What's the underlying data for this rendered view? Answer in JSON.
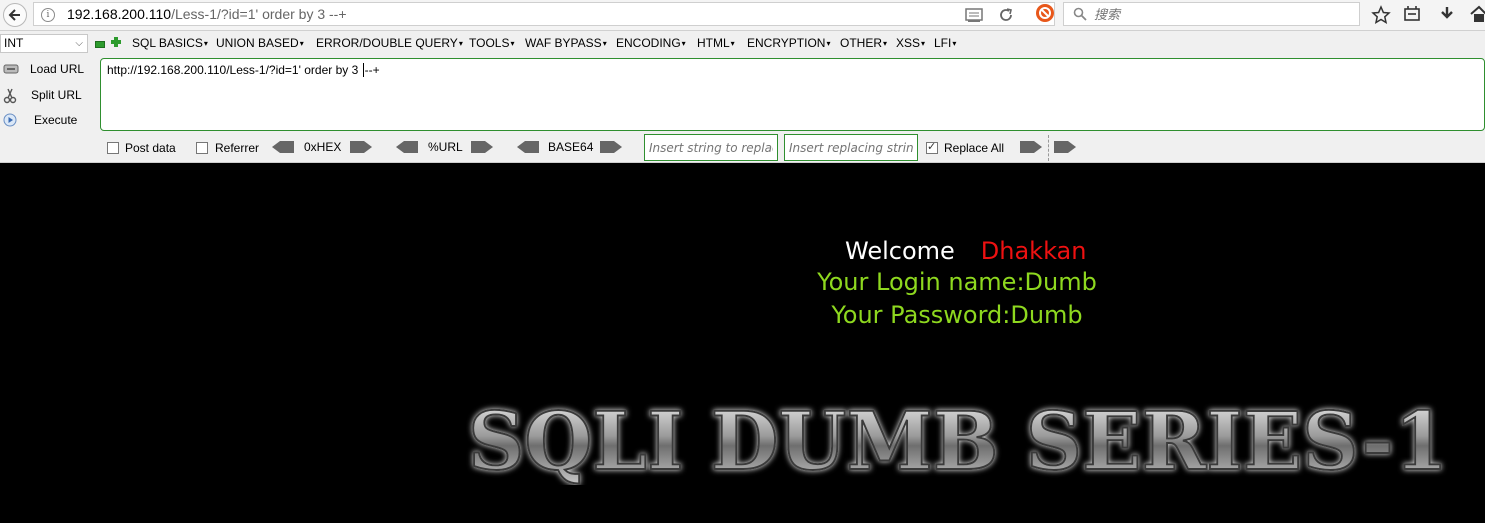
{
  "browser": {
    "url_host": "192.168.200.110",
    "url_path": "/Less-1/?id=1' order by 3 --+",
    "search_placeholder": "搜索"
  },
  "hackbar": {
    "type_select": "INT",
    "menus": [
      "SQL BASICS",
      "UNION BASED",
      "ERROR/DOUBLE QUERY",
      "TOOLS",
      "WAF BYPASS",
      "ENCODING",
      "HTML",
      "ENCRYPTION",
      "OTHER",
      "XSS",
      "LFI"
    ],
    "load_url": "Load URL",
    "split_url": "Split URL",
    "execute": "Execute",
    "url_value_before_caret": "http://192.168.200.110/Less-1/?id=1' order by 3 ",
    "url_value_after_caret": "--+",
    "post_data": "Post data",
    "referrer": "Referrer",
    "hex": "0xHEX",
    "url_enc": "%URL",
    "base64": "BASE64",
    "replace_placeholder": "Insert string to replace",
    "replacing_placeholder": "Insert replacing string",
    "replace_all": "Replace All",
    "replace_all_checked": true
  },
  "page": {
    "welcome": "Welcome",
    "name": "Dhakkan",
    "login_name": "Your Login name:Dumb",
    "password": "Your Password:Dumb",
    "banner": "SQLI DUMB SERIES-1"
  },
  "colors": {
    "name_red": "#e11111",
    "login_green": "#8ed81f",
    "hackbar_green": "#2f8f2f"
  }
}
